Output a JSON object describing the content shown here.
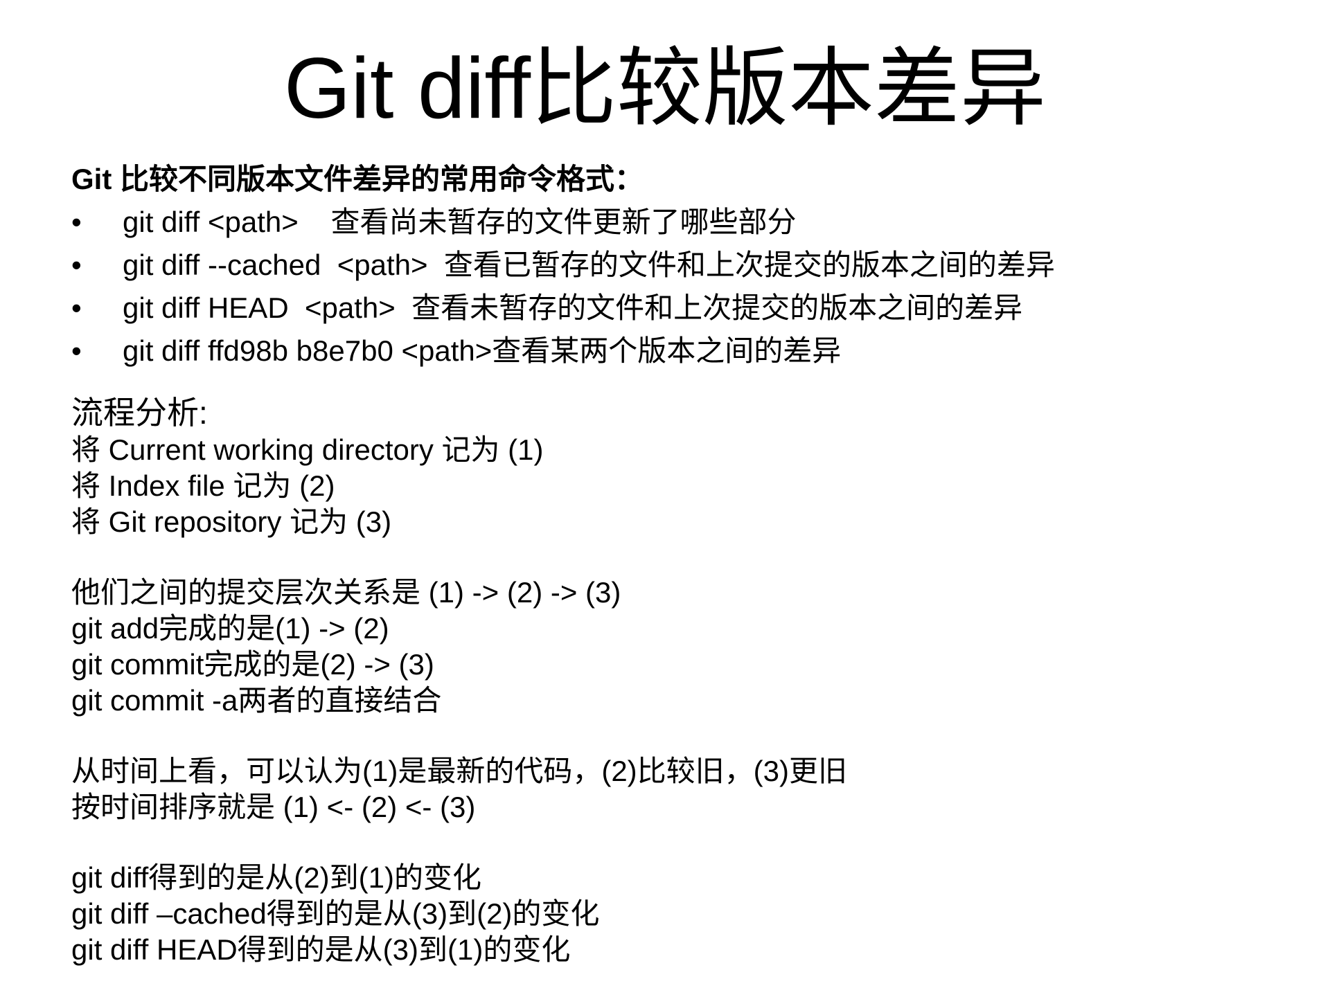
{
  "title": "Git diff比较版本差异",
  "intro": "Git 比较不同版本文件差异的常用命令格式：",
  "bullet_glyph": "•",
  "bullets": [
    "git diff <path>    查看尚未暂存的文件更新了哪些部分",
    "git diff --cached  <path>  查看已暂存的文件和上次提交的版本之间的差异",
    "git diff HEAD  <path>  查看未暂存的文件和上次提交的版本之间的差异",
    "git diff ffd98b b8e7b0 <path>查看某两个版本之间的差异"
  ],
  "flow": {
    "heading": "流程分析:",
    "lines": [
      "将 Current working directory 记为 (1)",
      "将 Index file 记为 (2)",
      "将 Git repository 记为 (3)"
    ]
  },
  "order": {
    "lines": [
      "他们之间的提交层次关系是 (1) -> (2) -> (3)",
      "git add完成的是(1) -> (2)",
      "git commit完成的是(2) -> (3)",
      "git commit -a两者的直接结合"
    ]
  },
  "time": {
    "lines": [
      "从时间上看，可以认为(1)是最新的代码，(2)比较旧，(3)更旧",
      "按时间排序就是 (1) <- (2) <- (3)"
    ]
  },
  "diff": {
    "lines": [
      "git diff得到的是从(2)到(1)的变化",
      "git diff –cached得到的是从(3)到(2)的变化",
      "git diff HEAD得到的是从(3)到(1)的变化"
    ]
  }
}
